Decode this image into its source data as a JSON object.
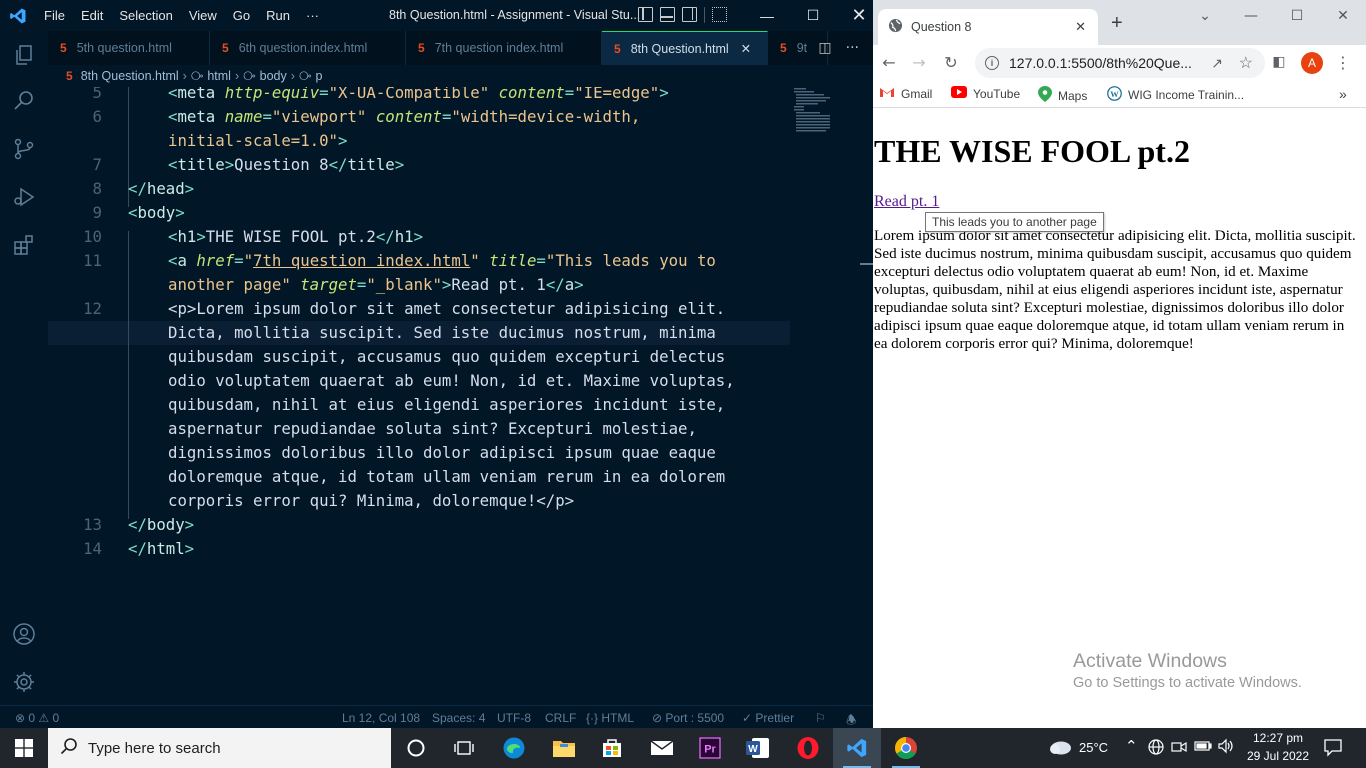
{
  "vscode": {
    "menu": [
      "File",
      "Edit",
      "Selection",
      "View",
      "Go",
      "Run",
      "···"
    ],
    "window_title": "8th Question.html - Assignment - Visual Stu...",
    "tabs": [
      {
        "label": "5th question.html",
        "active": false
      },
      {
        "label": "6th question.index.html",
        "active": false
      },
      {
        "label": "7th question index.html",
        "active": false
      },
      {
        "label": "8th Question.html",
        "active": true
      },
      {
        "label": "9t",
        "active": false
      }
    ],
    "tab_close": "✕",
    "breadcrumb": [
      "8th Question.html",
      "html",
      "body",
      "p"
    ],
    "line_numbers": [
      "5",
      "6",
      "",
      "7",
      "8",
      "9",
      "10",
      "11",
      "",
      "12",
      "",
      "",
      "",
      "",
      "",
      "",
      "",
      "",
      "13",
      "14"
    ],
    "lines": {
      "l5": {
        "open": "<",
        "tag": "meta",
        "a1": "http-equiv",
        "eq1": "=",
        "v1": "\"X-UA-Compatible\"",
        "a2": "content",
        "eq2": "=",
        "v2": "\"IE=edge\"",
        "close": ">"
      },
      "l6": {
        "open": "<",
        "tag": "meta",
        "a1": "name",
        "eq1": "=",
        "v1": "\"viewport\"",
        "a2": "content",
        "eq2": "=",
        "v2a": "\"width=device-width,"
      },
      "l6b": {
        "v2b": "initial-scale=1.0\"",
        "close": ">"
      },
      "l7": {
        "o1": "<",
        "t1": "title",
        "c1": ">",
        "text": "Question 8",
        "o2": "</",
        "t2": "title",
        "c2": ">"
      },
      "l8": {
        "o": "</",
        "t": "head",
        "c": ">"
      },
      "l9": {
        "o": "<",
        "t": "body",
        "c": ">"
      },
      "l10": {
        "o1": "<",
        "t1": "h1",
        "c1": ">",
        "text": "THE WISE FOOL pt.2",
        "o2": "</",
        "t2": "h1",
        "c2": ">"
      },
      "l11": {
        "o": "<",
        "t": "a",
        "a1": "href",
        "eq1": "=",
        "q1": "\"",
        "link": "7th question index.html",
        "q2": "\"",
        "a2": "title",
        "eq2": "=",
        "v2a": "\"This leads you to"
      },
      "l11b": {
        "v2b": "another page\"",
        "a3": "target",
        "eq3": "=",
        "v3": "\"_blank\"",
        "c": ">",
        "text": "Read pt. 1",
        "o2": "</",
        "t2": "a",
        "c2": ">"
      },
      "l12": [
        "<p>Lorem ipsum dolor sit amet consectetur adipisicing elit.",
        "Dicta, mollitia suscipit. Sed iste ducimus nostrum, minima",
        "quibusdam suscipit, accusamus quo quidem excepturi delectus",
        "odio voluptatem quaerat ab eum! Non, id et. Maxime voluptas,",
        "quibusdam, nihil at eius eligendi asperiores incidunt iste,",
        "aspernatur repudiandae soluta sint? Excepturi molestiae,",
        "dignissimos doloribus illo dolor adipisci ipsum quae eaque",
        "doloremque atque, id totam ullam veniam rerum in ea dolorem",
        "corporis error qui? Minima, doloremque!</p>"
      ],
      "l13": {
        "o": "</",
        "t": "body",
        "c": ">"
      },
      "l14": {
        "o": "</",
        "t": "html",
        "c": ">"
      }
    },
    "status": {
      "errors": "0",
      "warnings": "0",
      "position": "Ln 12, Col 108",
      "spaces": "Spaces: 4",
      "encoding": "UTF-8",
      "eol": "CRLF",
      "language": "HTML",
      "port": "Port : 5500",
      "prettier": "Prettier"
    },
    "colors": {
      "bg": "#011627",
      "accent": "#22da6e",
      "html_icon": "#e44d26"
    }
  },
  "chrome": {
    "tab_title": "Question 8",
    "new_tab": "+",
    "url": "127.0.0.1:5500/8th%20Que...",
    "avatar_letter": "A",
    "bookmarks": [
      "Gmail",
      "YouTube",
      "Maps",
      "WIG Income Trainin..."
    ],
    "bookmarks_more": "»",
    "page": {
      "h1": "THE WISE FOOL pt.2",
      "link": "Read pt. 1",
      "link_title": "This leads you to another page",
      "paragraph": "Lorem ipsum dolor sit amet consectetur adipisicing elit. Dicta, mollitia suscipit. Sed iste ducimus nostrum, minima quibusdam suscipit, accusamus quo quidem excepturi delectus odio voluptatem quaerat ab eum! Non, id et. Maxime voluptas, quibusdam, nihil at eius eligendi asperiores incidunt iste, aspernatur repudiandae soluta sint? Excepturi molestiae, dignissimos doloribus illo dolor adipisci ipsum quae eaque doloremque atque, id totam ullam veniam rerum in ea dolorem corporis error qui? Minima, doloremque!"
    },
    "tooltip": "This leads you to another page",
    "watermark": {
      "line1": "Activate Windows",
      "line2": "Go to Settings to activate Windows."
    }
  },
  "taskbar": {
    "search_placeholder": "Type here to search",
    "apps": [
      "task-view",
      "edge",
      "file-explorer",
      "microsoft-store",
      "mail",
      "premiere-pro",
      "word",
      "opera",
      "vscode",
      "chrome"
    ],
    "weather": "25°C",
    "time": "12:27 pm",
    "date": "29 Jul 2022"
  }
}
